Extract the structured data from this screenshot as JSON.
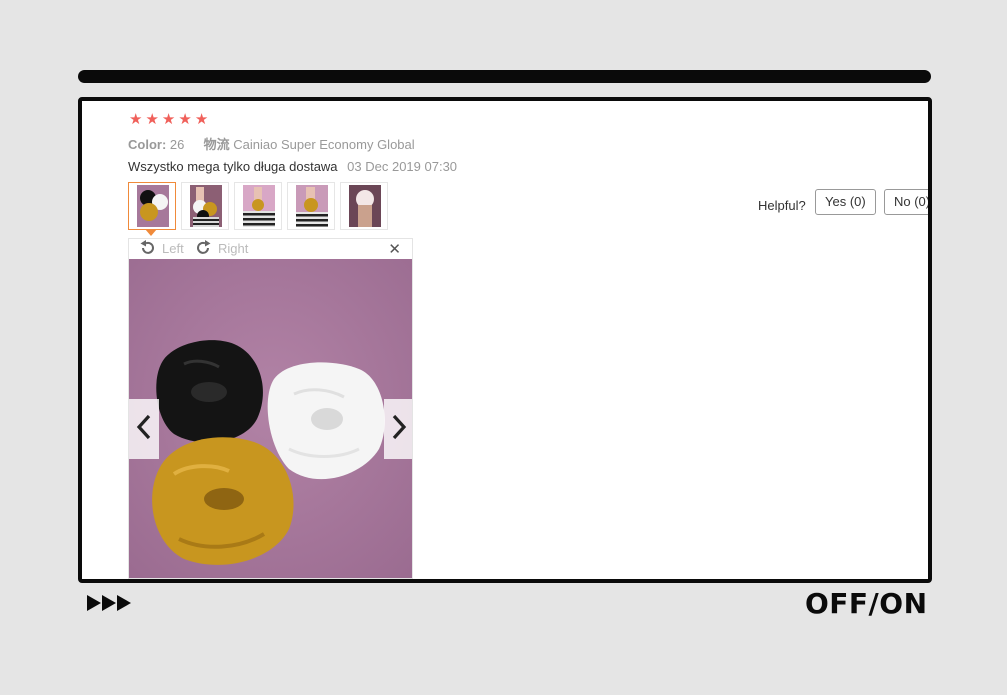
{
  "review": {
    "rating": 5,
    "color_label": "Color:",
    "color_value": "26",
    "shipping_label": "物流",
    "shipping_value": "Cainiao Super Economy Global",
    "text": "Wszystko mega tylko długa dostawa",
    "date": "03 Dec 2019 07:30",
    "thumbnail_count": 5,
    "active_thumbnail": 0
  },
  "viewer": {
    "rotate_left_label": "Left",
    "rotate_right_label": "Right",
    "close_glyph": "✕"
  },
  "helpful": {
    "label": "Helpful?",
    "yes_label": "Yes (0)",
    "no_label": "No (0)"
  },
  "player": {
    "toggle_label": "OFF/ON"
  },
  "icons": {
    "star": "star-icon",
    "rotate_left": "rotate-left-icon",
    "rotate_right": "rotate-right-icon",
    "close": "close-icon",
    "prev": "chevron-left-icon",
    "next": "chevron-right-icon",
    "fast_forward": "fast-forward-icon"
  },
  "colors": {
    "star": "#f0605a",
    "active_thumb_border": "#f08a3a",
    "photo_background": "#a6789a"
  }
}
